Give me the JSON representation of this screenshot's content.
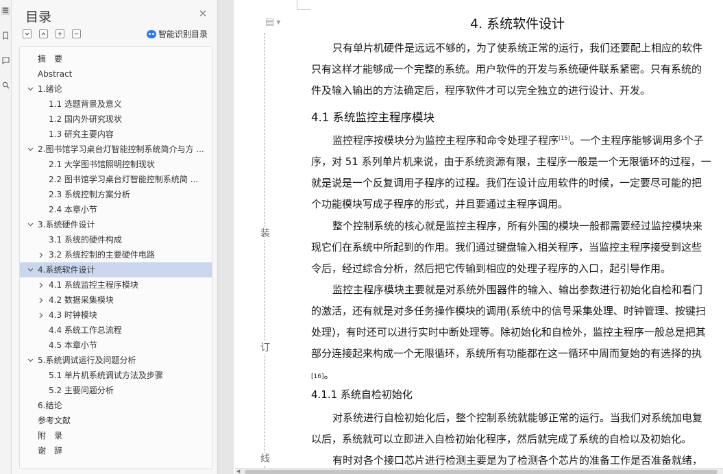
{
  "sidebar_strip": {
    "icons": [
      "toc-icon",
      "bookmark-icon",
      "comment-icon",
      "find-icon"
    ]
  },
  "toc": {
    "title": "目录",
    "ai_label": "智能识别目录",
    "items": [
      {
        "label": "摘　要",
        "level": 1,
        "expand": "none"
      },
      {
        "label": "Abstract",
        "level": 1,
        "expand": "none"
      },
      {
        "label": "1.绪论",
        "level": 1,
        "expand": "open"
      },
      {
        "label": "1.1  选题背景及意义",
        "level": 2,
        "expand": "none"
      },
      {
        "label": "1.2  国内外研究现状",
        "level": 2,
        "expand": "none"
      },
      {
        "label": "1.3  研究主要内容",
        "level": 2,
        "expand": "none"
      },
      {
        "label": "2.图书馆学习桌台灯智能控制系统简介与方 ...",
        "level": 1,
        "expand": "open"
      },
      {
        "label": "2.1  大学图书馆照明控制现状",
        "level": 2,
        "expand": "none"
      },
      {
        "label": "2.2  图书馆学习桌台灯智能控制系统简 ...",
        "level": 2,
        "expand": "none"
      },
      {
        "label": "2.3  系统控制方案分析",
        "level": 2,
        "expand": "none"
      },
      {
        "label": "2.4  本章小节",
        "level": 2,
        "expand": "none"
      },
      {
        "label": "3.系统硬件设计",
        "level": 1,
        "expand": "open"
      },
      {
        "label": "3.1  系统的硬件构成",
        "level": 2,
        "expand": "none"
      },
      {
        "label": "3.2  系统控制的主要硬件电路",
        "level": 2,
        "expand": "closed"
      },
      {
        "label": "4.系统软件设计",
        "level": 1,
        "expand": "open",
        "selected": true
      },
      {
        "label": "4.1 系统监控主程序模块",
        "level": 2,
        "expand": "closed"
      },
      {
        "label": "4.2  数据采集模块",
        "level": 2,
        "expand": "closed"
      },
      {
        "label": "4.3  时钟模块",
        "level": 2,
        "expand": "closed"
      },
      {
        "label": "4.4  系统工作总流程",
        "level": 2,
        "expand": "none"
      },
      {
        "label": "4.5  本章小节",
        "level": 2,
        "expand": "none"
      },
      {
        "label": "5.系统调试运行及问题分析",
        "level": 1,
        "expand": "open"
      },
      {
        "label": "5.1  单片机系统调试方法及步骤",
        "level": 2,
        "expand": "none"
      },
      {
        "label": "5.2  主要问题分析",
        "level": 2,
        "expand": "none"
      },
      {
        "label": "6.结论",
        "level": 1,
        "expand": "none"
      },
      {
        "label": "参考文献",
        "level": 1,
        "expand": "none"
      },
      {
        "label": "附　录",
        "level": 1,
        "expand": "none"
      },
      {
        "label": "谢　辞",
        "level": 1,
        "expand": "none"
      }
    ]
  },
  "document": {
    "binding_marks": [
      "装",
      "订",
      "线"
    ],
    "heading": "4.  系统软件设计",
    "para1": [
      "只有单片机硬件是远远不够的，为了使系统正常的运行，我们还要配上相应的软件",
      "只有这样才能够成一个完整的系统。用户软件的开发与系统硬件联系紧密。只有系统的",
      "件及输入输出的方法确定后，程序软件才可以完全独立的进行设计、开发。"
    ],
    "section_41": "4.1 系统监控主程序模块",
    "para2": [
      "监控程序按模块分为监控主程序和命令处理子程序",
      "[15]",
      "。一个主程序能够调用多个子",
      "序，对 51 系列单片机来说，由于系统资源有限，主程序一般是一个无限循环的过程，一",
      "就是说是一个反复调用子程序的过程。我们在设计应用软件的时候，一定要尽可能的把",
      "个功能模块写成子程序的形式，并且要通过主程序调用。"
    ],
    "para3": [
      "整个控制系统的核心就是监控主程序，所有外围的模块一般都需要经过监控模块来",
      "现它们在系统中所起到的作用。我们通过键盘输入相关程序，当监控主程序接受到这些",
      "令后，经过综合分析，然后把它传输到相应的处理子程序的入口，起引导作用。"
    ],
    "para4": [
      "监控主程序模块主要就是对系统外围器件的输入、输出参数进行初始化自检和看门",
      "的激活，还有就是对多任务操作模块的调用(系统中的信号采集处理、时钟管理、按键扫",
      "处理)，有时还可以进行实时中断处理等。除初始化和自检外，监控主程序一般总是把其",
      "部分连接起来构成一个无限循环，系统所有功能都在这一循环中周而复始的有选择的执",
      "[16]",
      "。"
    ],
    "section_411": "4.1.1  系统自检初始化",
    "para5": [
      "对系统进行自检初始化后，整个控制系统就能够正常的运行。当我们对系统加电复",
      "以后，系统就可以立即进入自检初始化程序，然后就完成了系统的自检以及初始化。"
    ],
    "para6": [
      "有时对各个接口芯片进行检测主要是为了检测各个芯片的准备工作是否准备就绪，"
    ]
  }
}
